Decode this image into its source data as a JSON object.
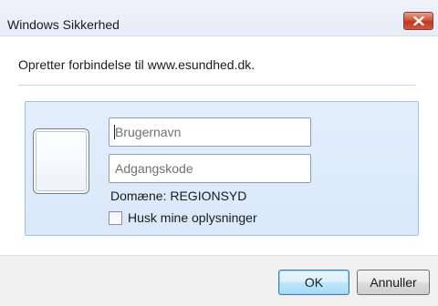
{
  "window": {
    "title": "Windows Sikkerhed",
    "message": "Opretter forbindelse til www.esundhed.dk."
  },
  "credentials": {
    "username_placeholder": "Brugernavn",
    "password_placeholder": "Adgangskode",
    "domain_text": "Domæne: REGIONSYD",
    "remember_label": "Husk mine oplysninger",
    "remember_checked": false
  },
  "buttons": {
    "ok_label": "OK",
    "cancel_label": "Annuller"
  },
  "icons": {
    "close": "close-icon",
    "avatar": "user-tile-icon",
    "checkbox": "checkbox-icon"
  },
  "colors": {
    "panel_bg": "#dce9fa",
    "panel_border": "#9fc1e6",
    "close_button": "#c9462f",
    "default_button_border": "#3c7fb1"
  }
}
